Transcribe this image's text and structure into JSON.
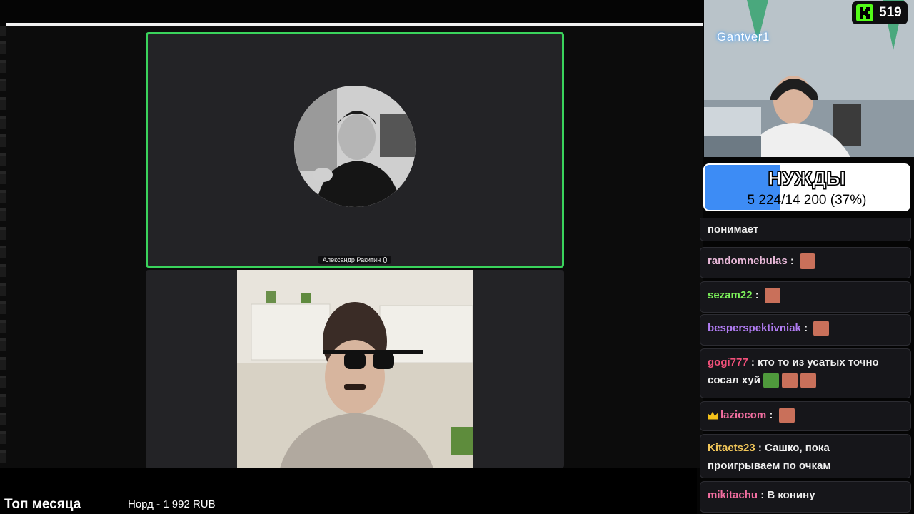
{
  "call": {
    "participant_name": "Александр Ракитин"
  },
  "webcam": {
    "streamer_label": "Gantver1"
  },
  "kick": {
    "viewer_count": "519",
    "brand_color": "#53fc18"
  },
  "goal": {
    "title": "НУЖДЫ",
    "amount": "5 224/14 200 (37%)",
    "progress": 0.37,
    "fill_color": "#3d8cf5"
  },
  "chat": {
    "messages": [
      {
        "user": "",
        "text": "понимает",
        "user_color": "#efefef"
      },
      {
        "user": "randomnebulas",
        "sep": ":",
        "text": "",
        "user_color": "#e8b8d8",
        "emotes": [
          "emote-face"
        ]
      },
      {
        "user": "sezam22",
        "sep": ":",
        "text": "",
        "user_color": "#7cf25a",
        "emotes": [
          "emote-face"
        ]
      },
      {
        "user": "besperspektivniak",
        "sep": ":",
        "text": "",
        "user_color": "#b07cf2",
        "emotes": [
          "emote-face"
        ]
      },
      {
        "user": "gogi777",
        "sep": ":",
        "text": "кто то из усатых точно сосал хуй",
        "user_color": "#f2507a",
        "emotes": [
          "pepe-emote",
          "emote-face",
          "emote-face"
        ]
      },
      {
        "user": "laziocom",
        "sep": ":",
        "text": "",
        "user_color": "#f26ea0",
        "emotes": [
          "emote-face"
        ]
      },
      {
        "user": "Kitaets23",
        "sep": ":",
        "text": "Сашко, пока проигрываем по очкам",
        "user_color": "#f2c75a"
      },
      {
        "user": "mikitachu",
        "sep": ":",
        "text": "В конину",
        "user_color": "#f26ea0"
      }
    ]
  },
  "bottom": {
    "top_month_label": "Топ месяца",
    "top_donor": "Норд - 1 992 RUB"
  }
}
